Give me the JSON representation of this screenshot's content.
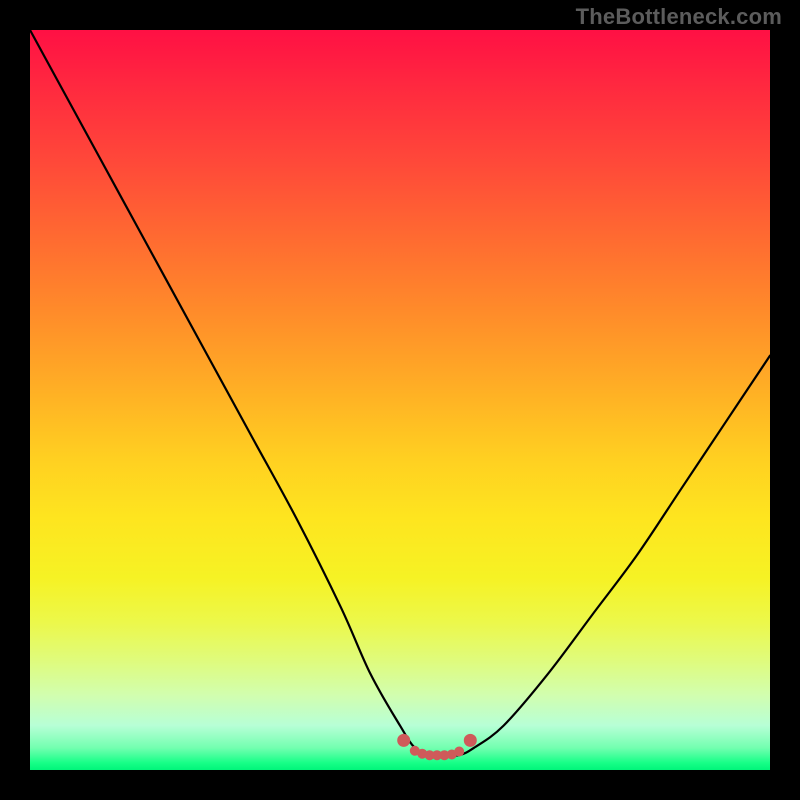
{
  "watermark": "TheBottleneck.com",
  "chart_data": {
    "type": "line",
    "title": "",
    "xlabel": "",
    "ylabel": "",
    "xlim": [
      0,
      100
    ],
    "ylim": [
      0,
      100
    ],
    "grid": false,
    "series": [
      {
        "name": "bottleneck-curve",
        "x": [
          0,
          6,
          12,
          18,
          24,
          30,
          36,
          42,
          46,
          50,
          52,
          54,
          56,
          58,
          60,
          64,
          70,
          76,
          82,
          88,
          94,
          100
        ],
        "values": [
          100,
          89,
          78,
          67,
          56,
          45,
          34,
          22,
          13,
          6,
          3,
          2,
          2,
          2,
          3,
          6,
          13,
          21,
          29,
          38,
          47,
          56
        ]
      }
    ],
    "markers": {
      "name": "valley-markers",
      "color": "#cf5a5a",
      "x": [
        50.5,
        52.0,
        53.0,
        54.0,
        55.0,
        56.0,
        57.0,
        58.0,
        59.5
      ],
      "values": [
        4.0,
        2.6,
        2.2,
        2.0,
        2.0,
        2.0,
        2.1,
        2.5,
        4.0
      ]
    },
    "background_gradient": {
      "top": "#ff1044",
      "mid": "#fee51f",
      "bottom": "#00f57a"
    }
  }
}
